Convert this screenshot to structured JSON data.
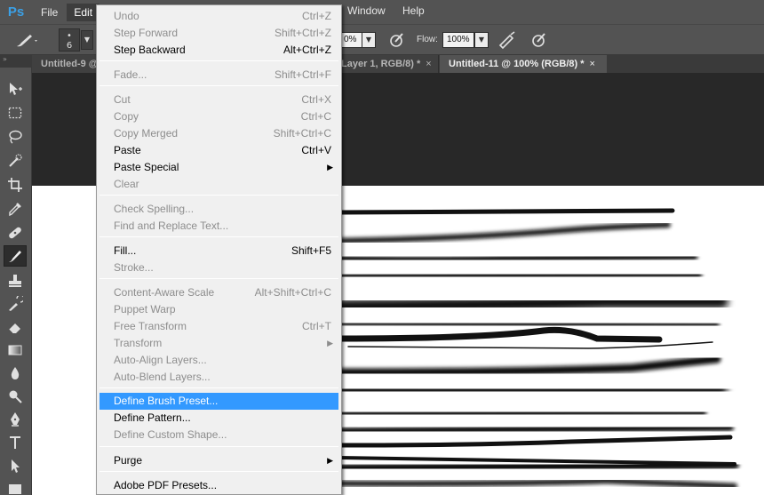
{
  "app": {
    "logo": "Ps"
  },
  "menubar": {
    "file": "File",
    "edit": "Edit",
    "window": "Window",
    "help": "Help"
  },
  "options": {
    "brush_size": "6",
    "opacity": "0%",
    "flow_label": "Flow:",
    "flow": "100%"
  },
  "tabs": [
    {
      "label": "Untitled-9 @",
      "close": ""
    },
    {
      "label": "Layer 1, RGB/8) *",
      "close": "×"
    },
    {
      "label": "Untitled-11 @ 100% (RGB/8) *",
      "close": "×"
    }
  ],
  "toolbox": {
    "collapse": "»",
    "tools": [
      "move-tool",
      "marquee-tool",
      "lasso-tool",
      "quick-selection-tool",
      "crop-tool",
      "eyedropper-tool",
      "healing-brush-tool",
      "brush-tool",
      "clone-stamp-tool",
      "history-brush-tool",
      "eraser-tool",
      "gradient-tool",
      "blur-tool",
      "dodge-tool",
      "pen-tool",
      "type-tool",
      "path-selection-tool",
      "rectangle-tool"
    ]
  },
  "edit_menu": {
    "items": [
      {
        "label": "Undo",
        "shortcut": "Ctrl+Z",
        "enabled": false
      },
      {
        "label": "Step Forward",
        "shortcut": "Shift+Ctrl+Z",
        "enabled": false
      },
      {
        "label": "Step Backward",
        "shortcut": "Alt+Ctrl+Z",
        "enabled": true
      },
      {
        "label": "Fade...",
        "shortcut": "Shift+Ctrl+F",
        "enabled": false
      },
      {
        "label": "Cut",
        "shortcut": "Ctrl+X",
        "enabled": false
      },
      {
        "label": "Copy",
        "shortcut": "Ctrl+C",
        "enabled": false
      },
      {
        "label": "Copy Merged",
        "shortcut": "Shift+Ctrl+C",
        "enabled": false
      },
      {
        "label": "Paste",
        "shortcut": "Ctrl+V",
        "enabled": true
      },
      {
        "label": "Paste Special",
        "shortcut": "",
        "enabled": true,
        "submenu": true
      },
      {
        "label": "Clear",
        "shortcut": "",
        "enabled": false
      },
      {
        "label": "Check Spelling...",
        "shortcut": "",
        "enabled": false
      },
      {
        "label": "Find and Replace Text...",
        "shortcut": "",
        "enabled": false
      },
      {
        "label": "Fill...",
        "shortcut": "Shift+F5",
        "enabled": true
      },
      {
        "label": "Stroke...",
        "shortcut": "",
        "enabled": false
      },
      {
        "label": "Content-Aware Scale",
        "shortcut": "Alt+Shift+Ctrl+C",
        "enabled": false
      },
      {
        "label": "Puppet Warp",
        "shortcut": "",
        "enabled": false
      },
      {
        "label": "Free Transform",
        "shortcut": "Ctrl+T",
        "enabled": false
      },
      {
        "label": "Transform",
        "shortcut": "",
        "enabled": false,
        "submenu": true
      },
      {
        "label": "Auto-Align Layers...",
        "shortcut": "",
        "enabled": false
      },
      {
        "label": "Auto-Blend Layers...",
        "shortcut": "",
        "enabled": false
      },
      {
        "label": "Define Brush Preset...",
        "shortcut": "",
        "enabled": true,
        "highlighted": true
      },
      {
        "label": "Define Pattern...",
        "shortcut": "",
        "enabled": true
      },
      {
        "label": "Define Custom Shape...",
        "shortcut": "",
        "enabled": false
      },
      {
        "label": "Purge",
        "shortcut": "",
        "enabled": true,
        "submenu": true
      },
      {
        "label": "Adobe PDF Presets...",
        "shortcut": "",
        "enabled": true
      }
    ],
    "submenu_arrow": "▶"
  },
  "colors": {
    "menu_highlight": "#3399ff",
    "ps_logo": "#3ba0e6",
    "ui_dark": "#535353",
    "workspace": "#282828"
  }
}
